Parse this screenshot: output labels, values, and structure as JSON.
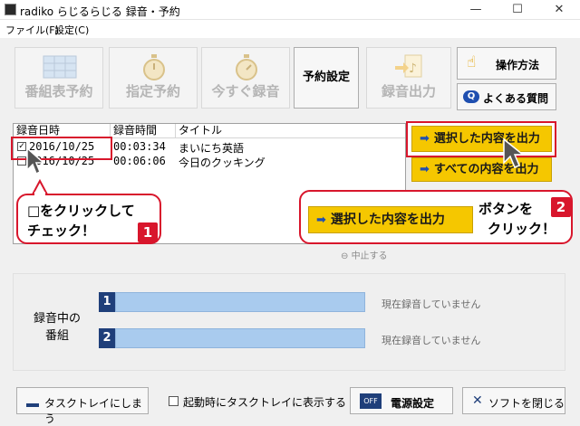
{
  "window": {
    "title": "radiko らじるらじる 録音・予約",
    "controls": [
      "—",
      "☐",
      "✕"
    ]
  },
  "menu": [
    "ファイル(F)",
    "設定(C)"
  ],
  "toolbar": {
    "program_reserve": "番組表予約",
    "specified_reserve": "指定予約",
    "record_now": "今すぐ録音",
    "reserve_settings": "予約設定",
    "record_output": "録音出力",
    "how_to": "操作方法",
    "faq": "よくある質問"
  },
  "list": {
    "columns": [
      "録音日時",
      "録音時間",
      "タイトル"
    ],
    "rows": [
      {
        "checked": true,
        "date": "2016/10/25",
        "duration": "00:03:34",
        "title": "まいにち英語"
      },
      {
        "checked": false,
        "date": "2016/10/25",
        "duration": "00:06:06",
        "title": "今日のクッキング"
      }
    ]
  },
  "actions": {
    "output_selected": "選択した内容を出力",
    "output_all": "すべての内容を出力",
    "stop": "中止する"
  },
  "callout1": {
    "line1": "□をクリックして",
    "line2": "チェック！",
    "badge": "1"
  },
  "callout2": {
    "button": "選択した内容を出力",
    "line1": "ボタンを",
    "line2": "クリック！",
    "badge": "2"
  },
  "recording": {
    "label_line1": "録音中の",
    "label_line2": "番組",
    "slots": [
      {
        "num": "1",
        "status": "現在録音していません"
      },
      {
        "num": "2",
        "status": "現在録音していません"
      }
    ]
  },
  "bottom": {
    "to_tray": "タスクトレイにしまう",
    "tray_on_start": "起動時にタスクトレイに表示する",
    "tray_checked": false,
    "power": "電源設定",
    "close": "ソフトを閉じる"
  }
}
